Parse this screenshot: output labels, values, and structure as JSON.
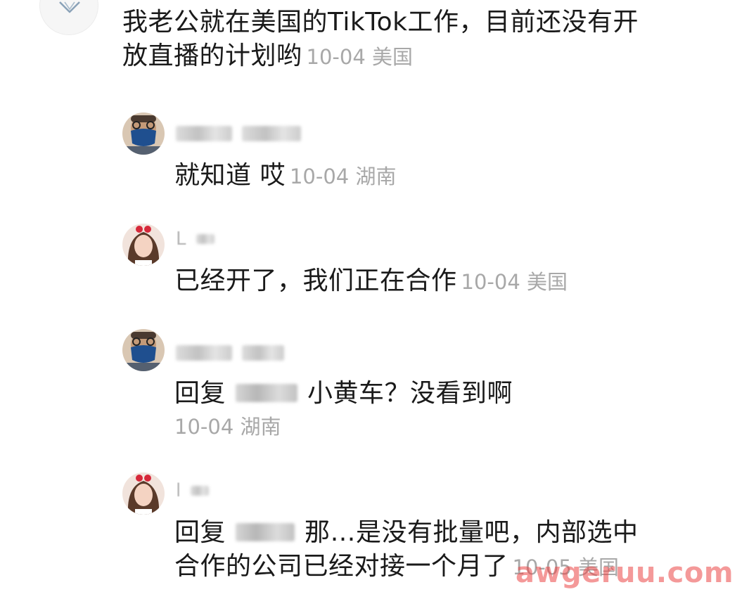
{
  "main_comment": {
    "line1": "我老公就在美国的TikTok工作，目前还没有开",
    "line2": "放直播的计划哟",
    "meta": "10-04 美国"
  },
  "replies": [
    {
      "text": "就知道 哎",
      "meta": "10-04 湖南"
    },
    {
      "initial": "L",
      "text": "已经开了，我们正在合作",
      "meta": "10-04 美国"
    },
    {
      "prefix": "回复",
      "text": "小黄车？没看到啊",
      "meta": "10-04 湖南"
    },
    {
      "initial": "l",
      "prefix": "回复",
      "text_line1": "那…是没有批量吧，内部选中",
      "text_line2": "合作的公司已经对接一个月了",
      "meta": "10-05 美国"
    }
  ],
  "watermark": "awgeruu.com",
  "colors": {
    "text": "#1a1a1a",
    "meta": "#a8a8a8",
    "watermark": "#eb4646",
    "mask_blue": "#1f4f8f"
  },
  "icons": {
    "top_avatar": "diamond-icon"
  }
}
